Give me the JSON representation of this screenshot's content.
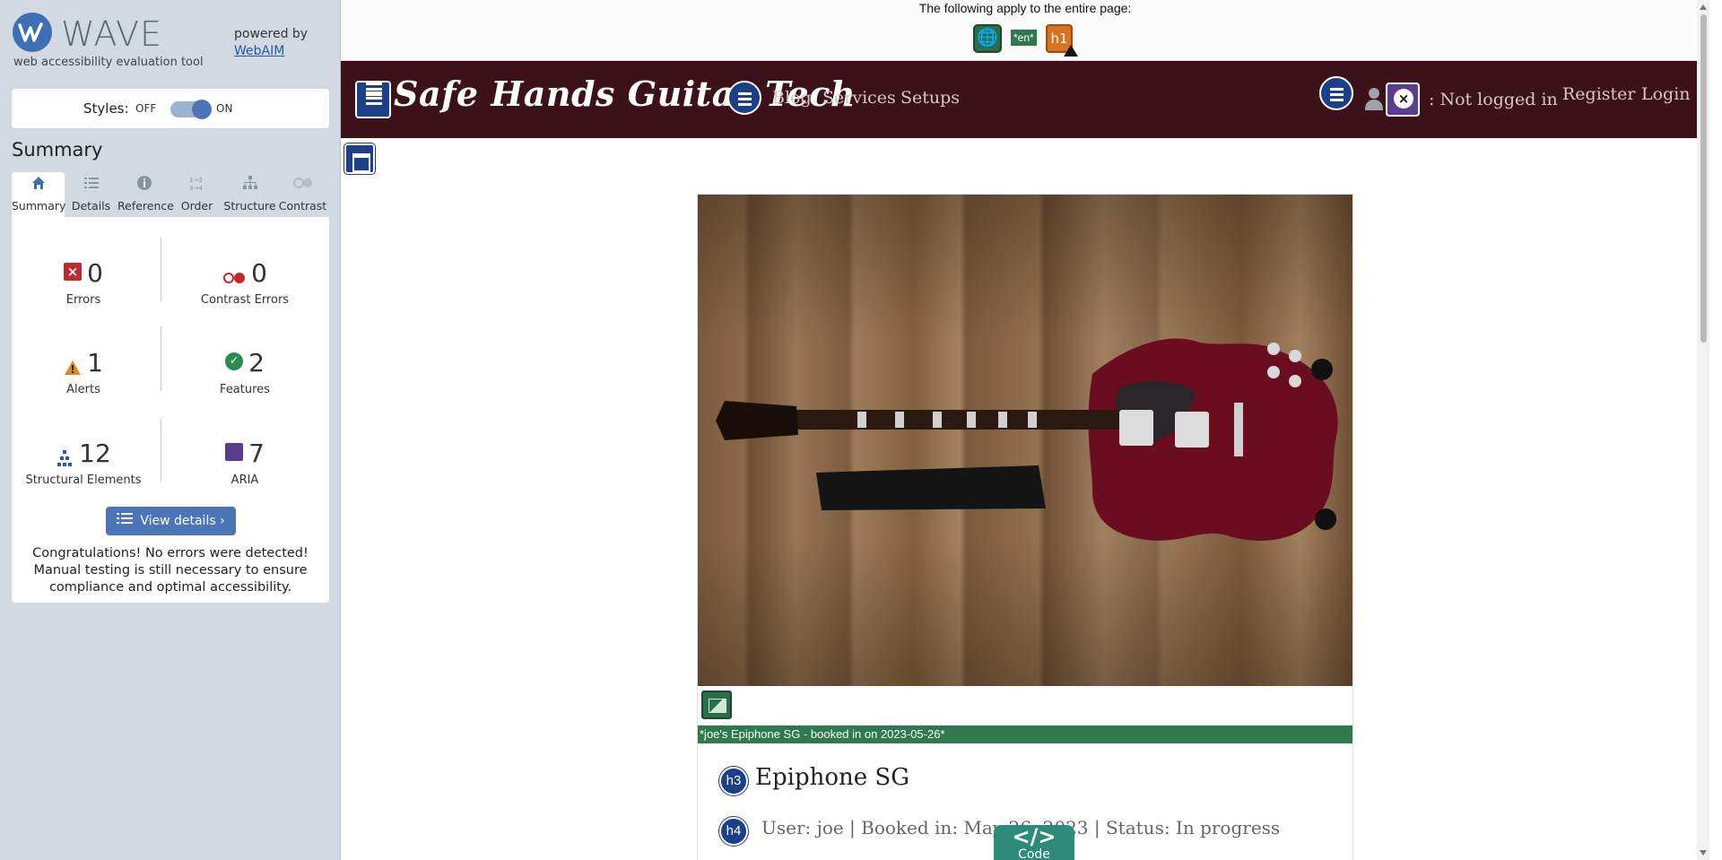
{
  "wave": {
    "logo_word": "WAVE",
    "tagline": "web accessibility evaluation tool",
    "powered_by": "powered by",
    "webaim_link": "WebAIM",
    "styles_label": "Styles:",
    "styles_off": "OFF",
    "styles_on": "ON",
    "styles_state": "on",
    "summary_title": "Summary",
    "tabs": [
      {
        "label": "Summary",
        "icon": "home-icon",
        "active": true
      },
      {
        "label": "Details",
        "icon": "list-icon",
        "active": false
      },
      {
        "label": "Reference",
        "icon": "info-icon",
        "active": false
      },
      {
        "label": "Order",
        "icon": "order-icon",
        "active": false
      },
      {
        "label": "Structure",
        "icon": "structure-icon",
        "active": false
      },
      {
        "label": "Contrast",
        "icon": "contrast-icon",
        "active": false
      }
    ],
    "stats": {
      "errors": {
        "count": "0",
        "label": "Errors"
      },
      "contrast_errors": {
        "count": "0",
        "label": "Contrast Errors"
      },
      "alerts": {
        "count": "1",
        "label": "Alerts"
      },
      "features": {
        "count": "2",
        "label": "Features"
      },
      "structural": {
        "count": "12",
        "label": "Structural Elements"
      },
      "aria": {
        "count": "7",
        "label": "ARIA"
      }
    },
    "view_details": "View details ›",
    "congrats": "Congratulations! No errors were detected! Manual testing is still necessary to ensure compliance and optimal accessibility.",
    "colors": {
      "accent": "#4c74b8",
      "error": "#c0282d",
      "alert": "#e08a1e",
      "feature": "#2e8b4f",
      "aria": "#5b3d8f"
    }
  },
  "page_note": {
    "text": "The following apply to the entire page:",
    "lang_badge": "*en*",
    "h1_badge": "h1"
  },
  "site": {
    "brand": "Safe Hands Guitar Tech",
    "nav": [
      "Blog",
      "Services",
      "Setups"
    ],
    "status": ": Not logged in",
    "register": "Register",
    "login": "Login",
    "nav_bg": "#3c1119"
  },
  "card": {
    "alt_text": "*joe's Epiphone SG - booked in on 2023-05-26*",
    "title_badge": "h3",
    "title": "Epiphone SG",
    "meta_badge": "h4",
    "meta": "User: joe | Booked in: May 26, 2023 | Status: In progress"
  },
  "code_tab": {
    "label": "Code",
    "glyph": "</>"
  }
}
